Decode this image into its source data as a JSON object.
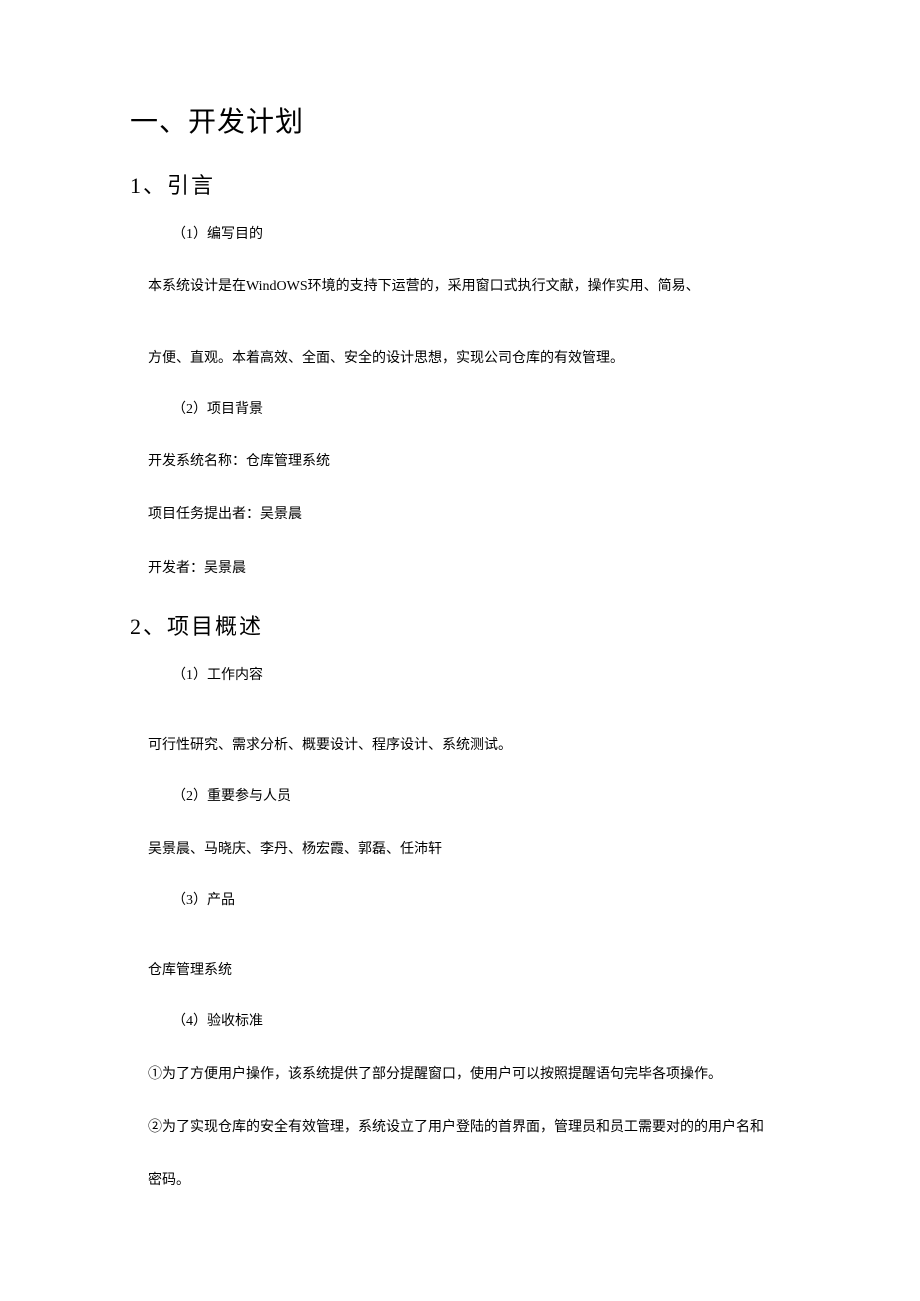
{
  "heading1": "一、开发计划",
  "section1": {
    "title": "1、引言",
    "item1_label": "（1）编写目的",
    "item1_text_a": "本系统设计是在WindOWS环境的支持下运营的，采用窗口式执行文献，操作实用、简易、",
    "item1_text_b": "方便、直观。本着高效、全面、安全的设计思想，实现公司仓库的有效管理。",
    "item2_label": "（2）项目背景",
    "item2_line1": "开发系统名称：仓库管理系统",
    "item2_line2": "项目任务提出者：吴景晨",
    "item2_line3": "开发者：吴景晨"
  },
  "section2": {
    "title": "2、项目概述",
    "item1_label": "（1）工作内容",
    "item1_text": "可行性研究、需求分析、概要设计、程序设计、系统测试。",
    "item2_label": "（2）重要参与人员",
    "item2_text": "吴景晨、马晓庆、李丹、杨宏霞、郭磊、任沛轩",
    "item3_label": "（3）产品",
    "item3_text": "仓库管理系统",
    "item4_label": "（4）验收标准",
    "item4_line1": "①为了方便用户操作，该系统提供了部分提醒窗口，使用户可以按照提醒语句完毕各项操作。",
    "item4_line2": "②为了实现仓库的安全有效管理，系统设立了用户登陆的首界面，管理员和员工需要对的的用户名和",
    "item4_line3": "密码。"
  }
}
